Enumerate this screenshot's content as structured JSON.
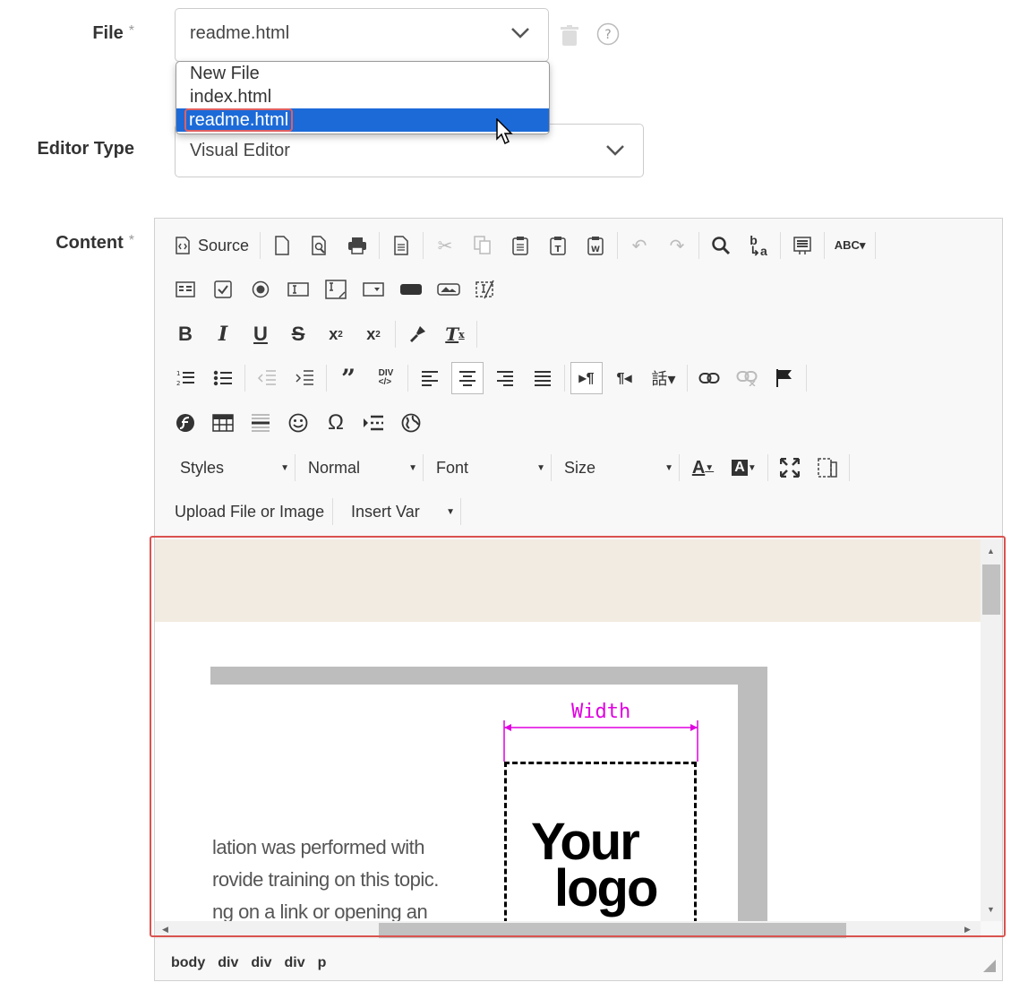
{
  "form": {
    "file_label": "File",
    "required_mark": "*",
    "file_value": "readme.html",
    "file_options": [
      "New File",
      "index.html",
      "readme.html"
    ],
    "editor_type_label": "Editor Type",
    "editor_type_value": "Visual Editor",
    "content_label": "Content"
  },
  "toolbar": {
    "source_label": "Source",
    "styles_label": "Styles",
    "format_label": "Normal",
    "font_label": "Font",
    "size_label": "Size",
    "upload_label": "Upload File or Image",
    "insert_var_label": "Insert Var"
  },
  "content": {
    "width_label": "Width",
    "logo_line1": "Your",
    "logo_line2": "logo",
    "text_lines": [
      "lation was performed with",
      "rovide training on this topic.",
      "ng on a link or opening an"
    ]
  },
  "pathbar": [
    "body",
    "div",
    "div",
    "div",
    "p"
  ],
  "colors": {
    "accent": "#1c6ad8",
    "highlight_border": "#d9534f",
    "banner": "#f2ebe1",
    "magenta": "#e000e0"
  }
}
